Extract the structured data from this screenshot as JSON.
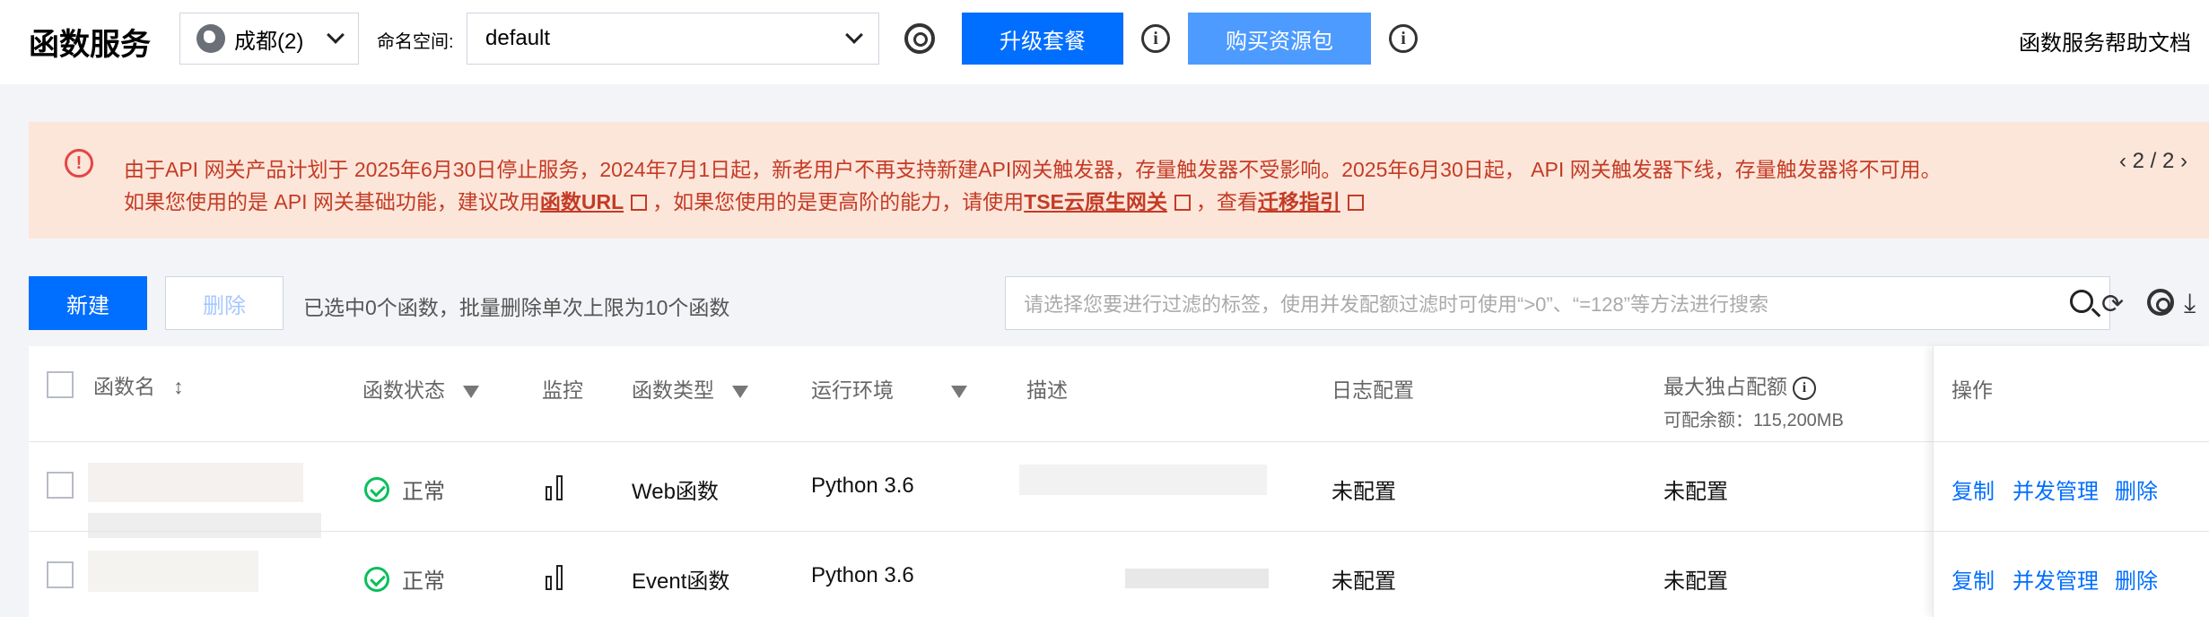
{
  "header": {
    "title": "函数服务",
    "region": "成都(2)",
    "namespace_label": "命名空间:",
    "namespace_value": "default",
    "upgrade_label": "升级套餐",
    "buy_label": "购买资源包",
    "help_label": "函数服务帮助文档"
  },
  "notice": {
    "line1": "由于API 网关产品计划于 2025年6月30日停止服务，2024年7月1日起，新老用户不再支持新建API网关触发器，存量触发器不受影响。2025年6月30日起， API 网关触发器下线，存量触发器将不可用。",
    "line2_a": "如果您使用的是 API 网关基础功能，建议改用",
    "link1": "函数URL",
    "line2_b": "，如果您使用的是更高阶的能力，请使用",
    "link2": "TSE云原生网关",
    "line2_c": "，查看",
    "link3": "迁移指引",
    "pager": "‹ 2 / 2 ›"
  },
  "toolbar": {
    "new_label": "新建",
    "delete_label": "删除",
    "selection_info": "已选中0个函数，批量删除单次上限为10个函数",
    "search_placeholder": "请选择您要进行过滤的标签，使用并发配额过滤时可使用“>0”、“=128”等方法进行搜索"
  },
  "table": {
    "headers": {
      "name": "函数名",
      "status": "函数状态",
      "monitor": "监控",
      "type": "函数类型",
      "runtime": "运行环境",
      "desc": "描述",
      "log": "日志配置",
      "quota": "最大独占配额",
      "quota_sub": "可配余额：115,200MB",
      "ops": "操作"
    },
    "rows": [
      {
        "status": "正常",
        "type": "Web函数",
        "runtime": "Python 3.6",
        "log": "未配置",
        "quota": "未配置",
        "op_copy": "复制",
        "op_conc": "并发管理",
        "op_del": "删除"
      },
      {
        "status": "正常",
        "type": "Event函数",
        "runtime": "Python 3.6",
        "log": "未配置",
        "quota": "未配置",
        "op_copy": "复制",
        "op_conc": "并发管理",
        "op_del": "删除"
      }
    ]
  },
  "colors": {
    "primary": "#006eff",
    "notice_bg": "#fce6d9",
    "notice_text": "#c43b26",
    "success": "#0abf5b"
  },
  "icons": [
    "globe-icon",
    "gear-icon",
    "info-icon",
    "warning-icon",
    "external-link-icon",
    "search-icon",
    "refresh-icon",
    "download-icon",
    "filter-icon",
    "sort-icon",
    "bar-chart-icon",
    "check-circle-icon"
  ]
}
